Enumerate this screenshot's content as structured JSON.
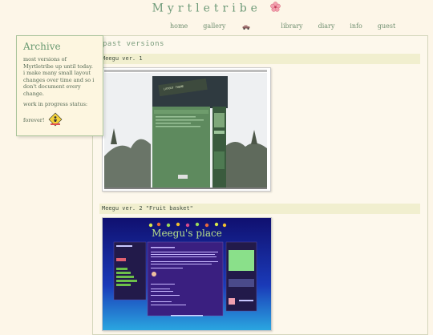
{
  "header": {
    "title": "Myrtletribe",
    "flower_icon": "hibiscus-flower-icon",
    "accent": "#e8788c"
  },
  "nav": {
    "items": [
      {
        "label": "home"
      },
      {
        "label": "gallery",
        "icon": "car-icon"
      },
      {
        "label": "library"
      },
      {
        "label": "diary"
      },
      {
        "label": "info"
      },
      {
        "label": "guest"
      }
    ]
  },
  "sidebar": {
    "title": "Archive",
    "description": "most versions of Myrtletribe up until today. i make many small layout changes over time and so i don't document every change.",
    "status_label": "work in progress status:",
    "status_value": "forever!",
    "status_icon": "construction-sign-icon"
  },
  "main": {
    "section_title": "past versions",
    "versions": [
      {
        "label": "Meegu ver. 1",
        "thumbnail_icon": "layout-screenshot-v1"
      },
      {
        "label": "Meegu ver. 2 \"Fruit basket\"",
        "thumbnail_icon": "layout-screenshot-v2",
        "inner_title": "Meegu's place"
      }
    ]
  },
  "colors": {
    "background": "#fdf6e8",
    "accent_green": "#6e9a78",
    "bar": "#f1efcf"
  }
}
